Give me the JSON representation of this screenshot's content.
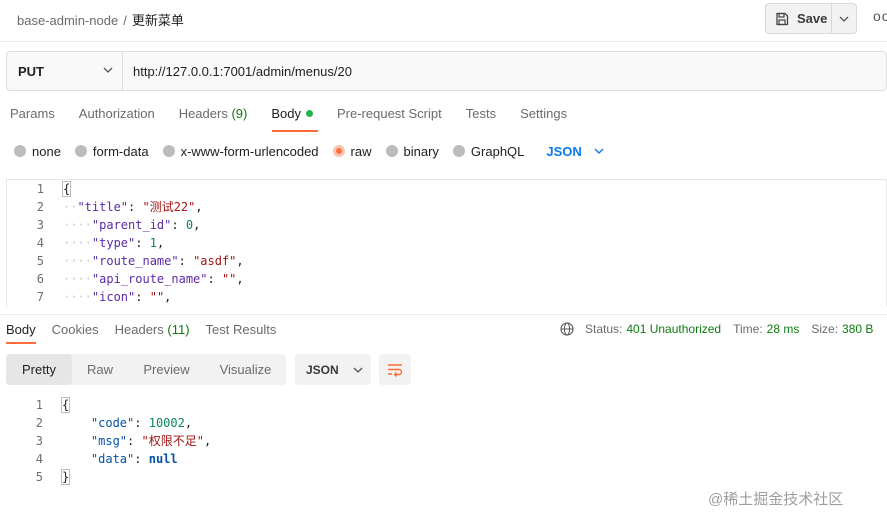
{
  "breadcrumb": {
    "collection": "base-admin-node",
    "separator": "/",
    "request": "更新菜单"
  },
  "toolbar": {
    "save_label": "Save",
    "more_label": "oo"
  },
  "request": {
    "method": "PUT",
    "url": "http://127.0.0.1:7001/admin/menus/20"
  },
  "request_tabs": [
    {
      "label": "Params"
    },
    {
      "label": "Authorization"
    },
    {
      "label": "Headers",
      "count": "(9)"
    },
    {
      "label": "Body"
    },
    {
      "label": "Pre-request Script"
    },
    {
      "label": "Tests"
    },
    {
      "label": "Settings"
    }
  ],
  "body_options": [
    {
      "label": "none"
    },
    {
      "label": "form-data"
    },
    {
      "label": "x-www-form-urlencoded"
    },
    {
      "label": "raw"
    },
    {
      "label": "binary"
    },
    {
      "label": "GraphQL"
    }
  ],
  "body_language": "JSON",
  "request_body": {
    "line_numbers": [
      "1",
      "2",
      "3",
      "4",
      "5",
      "6",
      "7"
    ],
    "open_brace": "{",
    "fields": [
      {
        "key": "\"title\"",
        "value": "\"测试22\""
      },
      {
        "key": "\"parent_id\"",
        "value": "0"
      },
      {
        "key": "\"type\"",
        "value": "1"
      },
      {
        "key": "\"route_name\"",
        "value": "\"asdf\""
      },
      {
        "key": "\"api_route_name\"",
        "value": "\"\""
      },
      {
        "key": "\"icon\"",
        "value": "\"\""
      }
    ]
  },
  "response_tabs": [
    {
      "label": "Body"
    },
    {
      "label": "Cookies"
    },
    {
      "label": "Headers",
      "count": "(11)"
    },
    {
      "label": "Test Results"
    }
  ],
  "response_status": {
    "status_label": "Status:",
    "status_value": "401 Unauthorized",
    "time_label": "Time:",
    "time_value": "28 ms",
    "size_label": "Size:",
    "size_value": "380 B"
  },
  "view_modes": [
    {
      "label": "Pretty"
    },
    {
      "label": "Raw"
    },
    {
      "label": "Preview"
    },
    {
      "label": "Visualize"
    }
  ],
  "response_format": "JSON",
  "response_body": {
    "line_numbers": [
      "1",
      "2",
      "3",
      "4",
      "5"
    ],
    "open_brace": "{",
    "close_brace": "}",
    "fields": [
      {
        "key": "\"code\"",
        "value": "10002"
      },
      {
        "key": "\"msg\"",
        "value": "\"权限不足\""
      },
      {
        "key": "\"data\"",
        "value": "null"
      }
    ]
  },
  "watermark": "@稀土掘金技术社区",
  "colors": {
    "accent": "#ff6c37",
    "status_ok": "#0f7b0f",
    "active_dot": "#26b14c",
    "link": "#097bed"
  }
}
